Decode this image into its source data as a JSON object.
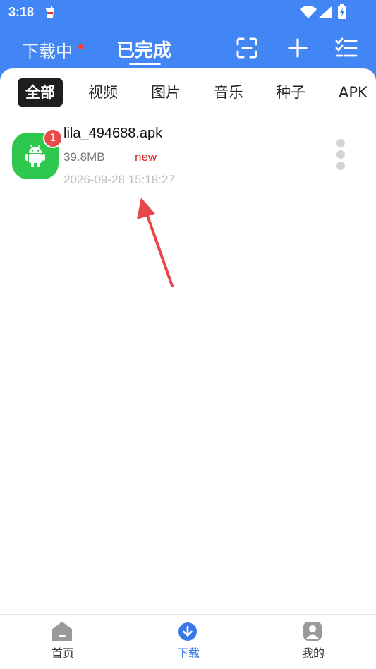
{
  "status_bar": {
    "time": "3:18"
  },
  "header": {
    "tab_downloading": "下载中",
    "tab_completed": "已完成",
    "icons": [
      "scan-icon",
      "add-icon",
      "checklist-icon"
    ]
  },
  "filters": [
    "全部",
    "视频",
    "图片",
    "音乐",
    "种子",
    "APK"
  ],
  "active_filter": "全部",
  "items": [
    {
      "badge": "1",
      "name": "lila_494688.apk",
      "size": "39.8MB",
      "tag": "new",
      "time": "2026-09-28 15:18:27",
      "icon": "android-icon"
    }
  ],
  "bottom_nav": [
    {
      "label": "首页",
      "icon": "home-icon"
    },
    {
      "label": "下载",
      "icon": "download-icon",
      "active": true
    },
    {
      "label": "我的",
      "icon": "profile-icon"
    }
  ],
  "colors": {
    "header_bg": "#4285f4",
    "app_icon_bg": "#2fc84f",
    "badge_bg": "#e94a4a",
    "new_tag": "#d0241b",
    "nav_active": "#3b78e7",
    "annotation_arrow": "#e9464a"
  }
}
